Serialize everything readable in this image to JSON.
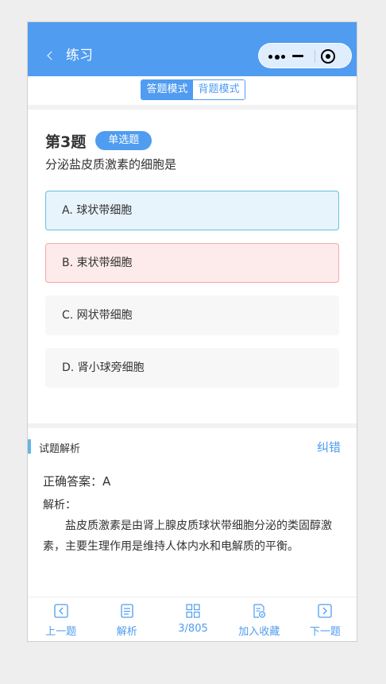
{
  "nav": {
    "back_icon": "chevron-left-icon",
    "title": "练习",
    "more_icon": "more-dots-icon",
    "minimize_icon": "minus-icon",
    "close_icon": "target-icon"
  },
  "mode": {
    "answer_mode": "答题模式",
    "review_mode": "背题模式",
    "active": "答题模式"
  },
  "question": {
    "number": "第3题",
    "type": "单选题",
    "text": "分泌盐皮质激素的细胞是",
    "options": [
      {
        "label": "A. 球状带细胞",
        "state": "correct"
      },
      {
        "label": "B. 束状带细胞",
        "state": "wrong"
      },
      {
        "label": "C. 网状带细胞",
        "state": "normal"
      },
      {
        "label": "D. 肾小球旁细胞",
        "state": "normal"
      }
    ]
  },
  "analysis": {
    "section_title": "试题解析",
    "report_label": "纠错",
    "answer_text": "正确答案：A",
    "analysis_label": "解析：",
    "analysis_body": "盐皮质激素是由肾上腺皮质球状带细胞分泌的类固醇激素，主要生理作用是维持人体内水和电解质的平衡。"
  },
  "tabbar": {
    "items": [
      {
        "label": "上一题",
        "icon": "prev-icon"
      },
      {
        "label": "解析",
        "icon": "document-icon"
      },
      {
        "label": "3/805",
        "icon": "grid-icon"
      },
      {
        "label": "加入收藏",
        "icon": "favorite-doc-icon"
      },
      {
        "label": "下一题",
        "icon": "next-icon"
      }
    ]
  },
  "colors": {
    "primary": "#4f9cf1",
    "correct_bg": "#e8f4fc",
    "wrong_bg": "#fdeaea"
  }
}
